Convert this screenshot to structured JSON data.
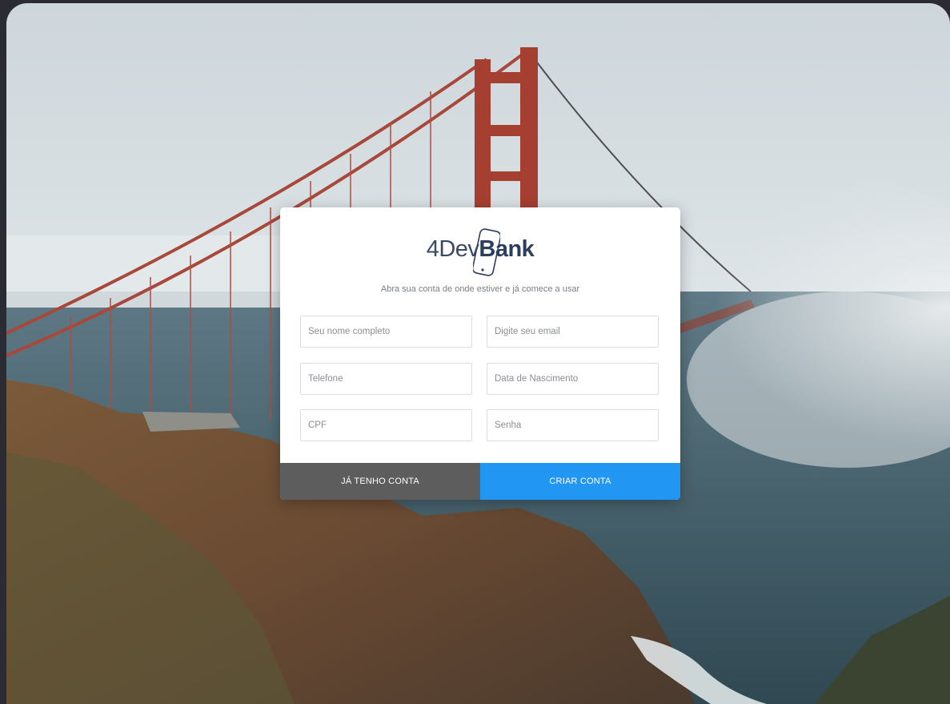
{
  "brand": {
    "logo_light": "4Dev",
    "logo_bold": "Bank"
  },
  "form": {
    "tagline": "Abra sua conta de onde estiver e já comece a usar",
    "fields": {
      "name": {
        "placeholder": "Seu nome completo",
        "value": ""
      },
      "email": {
        "placeholder": "Digite seu email",
        "value": ""
      },
      "phone": {
        "placeholder": "Telefone",
        "value": ""
      },
      "birthdate": {
        "placeholder": "Data de Nascimento",
        "value": ""
      },
      "cpf": {
        "placeholder": "CPF",
        "value": ""
      },
      "password": {
        "placeholder": "Senha",
        "value": ""
      }
    }
  },
  "actions": {
    "login_label": "JÁ TENHO CONTA",
    "create_label": "CRIAR CONTA"
  },
  "colors": {
    "primary": "#2196f3",
    "secondary": "#5d5d5e",
    "brand_text": "#2c3e5c"
  },
  "icons": {
    "logo_mark": "smartphone-outline-icon"
  }
}
